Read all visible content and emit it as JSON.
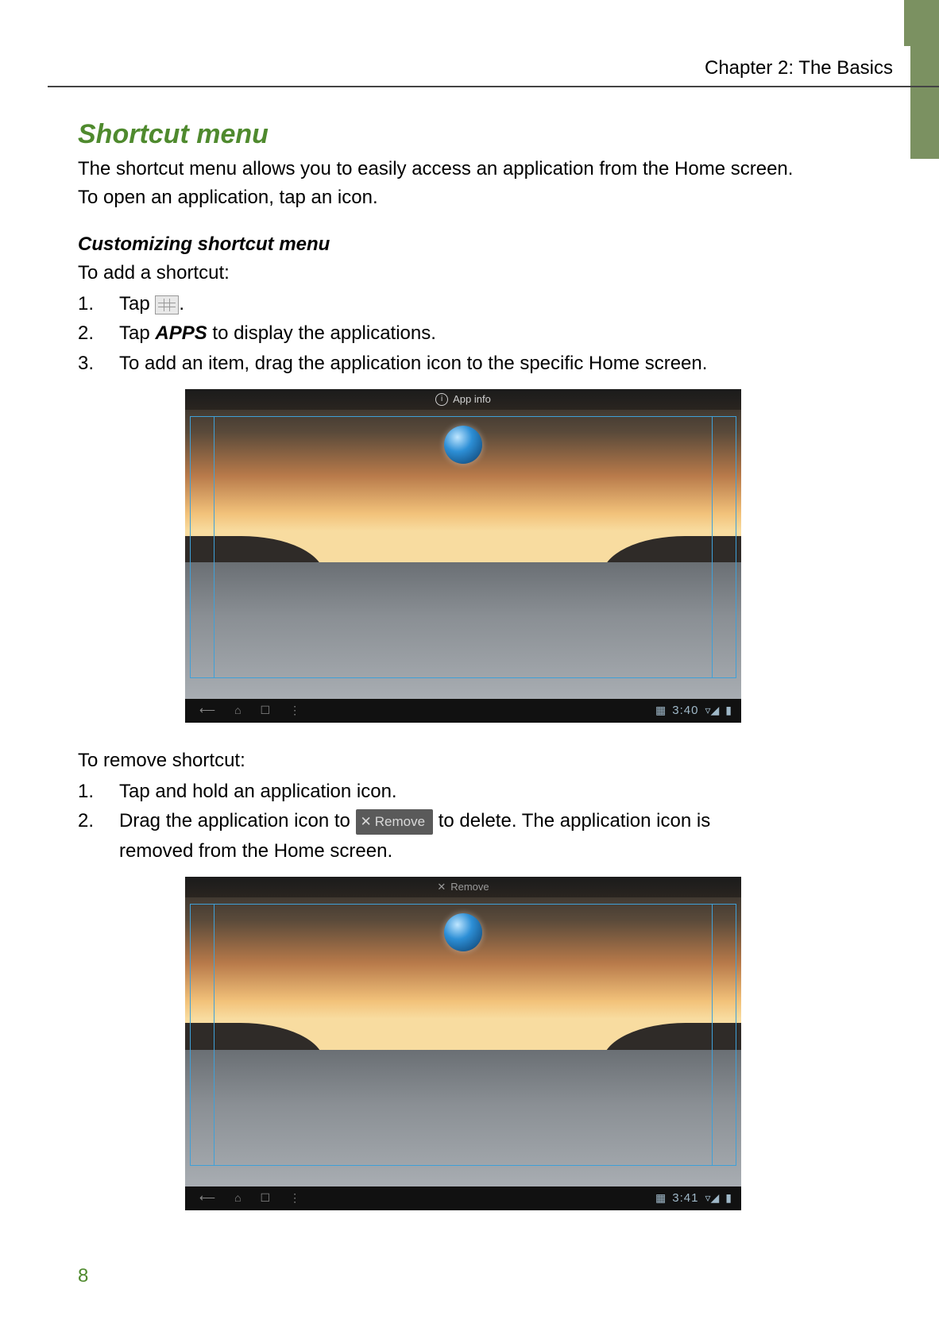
{
  "chapter_label": "Chapter 2: The Basics",
  "title": "Shortcut menu",
  "intro1": "The shortcut menu allows you to easily access an application from the Home screen.",
  "intro2": "To open an application, tap an icon.",
  "sub1": "Customizing shortcut menu",
  "add_label": "To add a shortcut:",
  "add_steps": {
    "n1": "1.",
    "t1a": "Tap ",
    "t1b": ".",
    "n2": "2.",
    "t2a": "Tap ",
    "t2_bold": "APPS",
    "t2b": " to display the applications.",
    "n3": "3.",
    "t3": "To add an item, drag the application icon to the specific Home screen."
  },
  "remove_label": "To remove shortcut:",
  "rem_steps": {
    "n1": "1.",
    "t1": "Tap and hold an application icon.",
    "n2": "2.",
    "t2a": " Drag the application icon to ",
    "t2b": " to delete. The application icon is",
    "t2c": "removed from the Home screen."
  },
  "fig1": {
    "topbar": "App info",
    "clock": "3:40"
  },
  "fig2": {
    "topbar": "Remove",
    "clock": "3:41"
  },
  "remove_button_text": "Remove",
  "page_number": "8"
}
